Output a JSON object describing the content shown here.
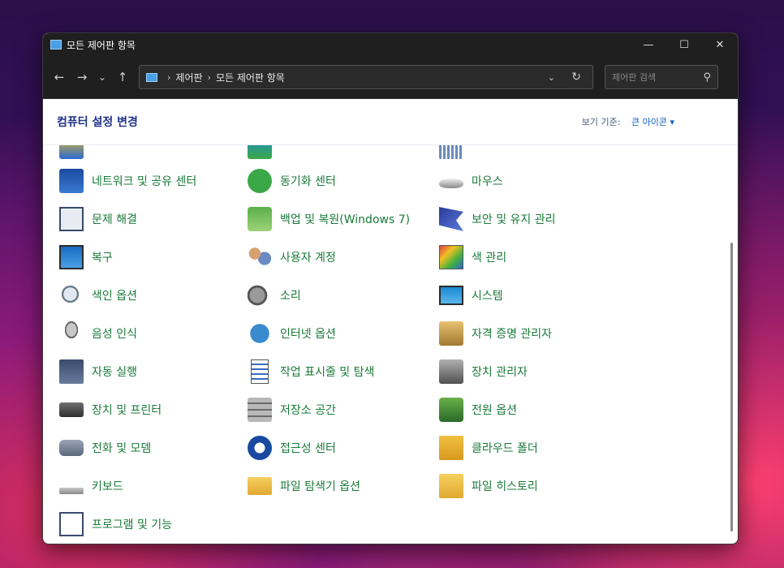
{
  "window": {
    "title": "모든 제어판 항목",
    "minimize": "—",
    "maximize": "☐",
    "close": "✕"
  },
  "nav": {
    "back": "←",
    "forward": "→",
    "recent": "⌄",
    "up": "↑",
    "breadcrumb": [
      "제어판",
      "모든 제어판 항목"
    ],
    "breadcrumb_sep": "›",
    "dropdown": "⌄",
    "refresh": "↻",
    "search_placeholder": "제어판 검색",
    "search_icon": "⚲"
  },
  "header": {
    "heading": "컴퓨터 설정 변경",
    "view_by_label": "보기 기준:",
    "view_by_value": "큰 아이콘 ▾"
  },
  "items": [
    {
      "label": "네트워크 및 공유 센터",
      "icon": "network-icon"
    },
    {
      "label": "동기화 센터",
      "icon": "sync-icon"
    },
    {
      "label": "마우스",
      "icon": "mouse-icon"
    },
    {
      "label": "문제 해결",
      "icon": "troubleshooting-icon"
    },
    {
      "label": "백업 및 복원(Windows 7)",
      "icon": "backup-icon"
    },
    {
      "label": "보안 및 유지 관리",
      "icon": "flag-icon"
    },
    {
      "label": "복구",
      "icon": "recovery-icon"
    },
    {
      "label": "사용자 계정",
      "icon": "users-icon"
    },
    {
      "label": "색 관리",
      "icon": "color-management-icon"
    },
    {
      "label": "색인 옵션",
      "icon": "indexing-icon"
    },
    {
      "label": "소리",
      "icon": "speaker-icon"
    },
    {
      "label": "시스템",
      "icon": "system-icon"
    },
    {
      "label": "음성 인식",
      "icon": "microphone-icon"
    },
    {
      "label": "인터넷 옵션",
      "icon": "internet-icon"
    },
    {
      "label": "자격 증명 관리자",
      "icon": "credential-icon"
    },
    {
      "label": "자동 실행",
      "icon": "autoplay-icon"
    },
    {
      "label": "작업 표시줄 및 탐색",
      "icon": "taskbar-icon"
    },
    {
      "label": "장치 관리자",
      "icon": "device-manager-icon"
    },
    {
      "label": "장치 및 프린터",
      "icon": "printer-icon"
    },
    {
      "label": "저장소 공간",
      "icon": "storage-icon"
    },
    {
      "label": "전원 옵션",
      "icon": "power-icon"
    },
    {
      "label": "전화 및 모뎀",
      "icon": "phone-icon"
    },
    {
      "label": "접근성 센터",
      "icon": "accessibility-icon"
    },
    {
      "label": "클라우드 폴더",
      "icon": "work-folders-icon"
    },
    {
      "label": "키보드",
      "icon": "keyboard-icon"
    },
    {
      "label": "파일 탐색기 옵션",
      "icon": "folder-options-icon"
    },
    {
      "label": "파일 히스토리",
      "icon": "file-history-icon"
    },
    {
      "label": "프로그램 및 기능",
      "icon": "programs-icon"
    }
  ]
}
